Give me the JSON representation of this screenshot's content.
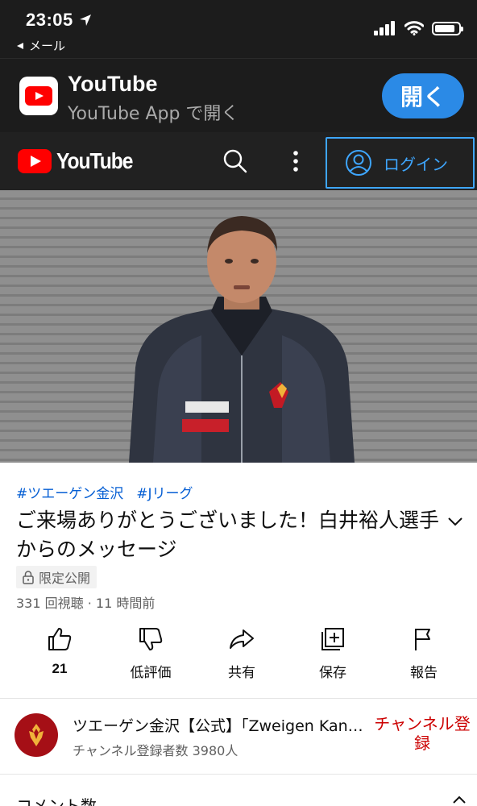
{
  "status_bar": {
    "time": "23:05",
    "back_label": "メール",
    "battery_level": 0.85
  },
  "app_banner": {
    "title": "YouTube",
    "subtitle": "YouTube App で開く",
    "open_label": "開く"
  },
  "header": {
    "logo_text": "YouTube",
    "login_label": "ログイン"
  },
  "video": {
    "hashtags": [
      "#ツエーゲン金沢",
      "#Jリーグ"
    ],
    "title": "ご来場ありがとうございました！白井裕人選手からのメッセージ",
    "privacy": "限定公開",
    "stats": "331 回視聴 · 11 時間前"
  },
  "actions": {
    "like_count": "21",
    "dislike_label": "低評価",
    "share_label": "共有",
    "save_label": "保存",
    "report_label": "報告"
  },
  "channel": {
    "name": "ツエーゲン金沢【公式】「Zweigen Kanazawa」",
    "subscribers": "チャンネル登録者数 3980人",
    "subscribe_label": "チャンネル登録"
  },
  "comments": {
    "label": "コメント数"
  },
  "colors": {
    "youtube_red": "#ff0000",
    "link_blue": "#065fd4",
    "accent_blue": "#3ea6ff",
    "subscribe_red": "#cc0000"
  }
}
